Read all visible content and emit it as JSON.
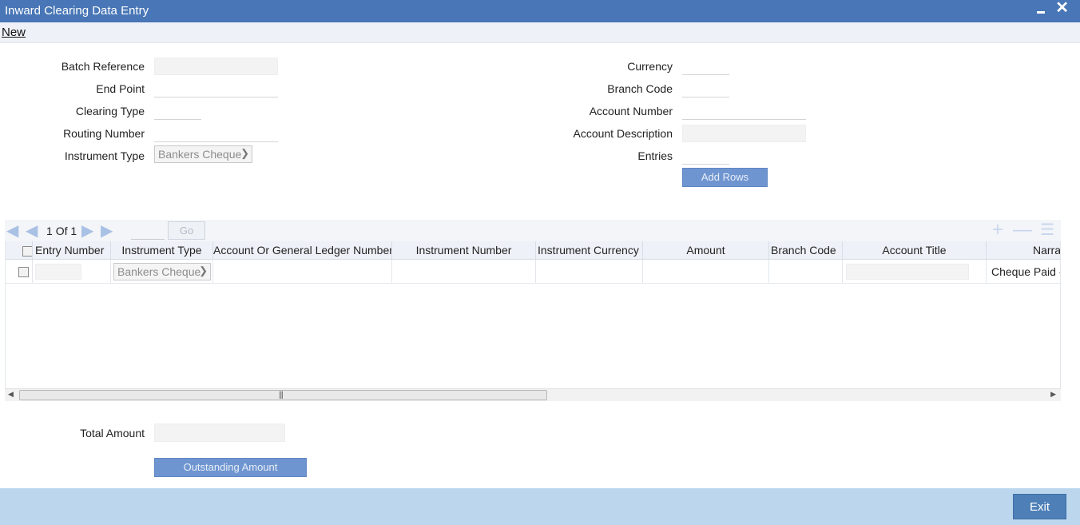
{
  "window": {
    "title": "Inward Clearing Data Entry",
    "minimize_glyph": "▬",
    "close_glyph": "✕"
  },
  "menu": {
    "new_label": "New"
  },
  "form": {
    "batch_reference_label": "Batch Reference",
    "end_point_label": "End Point",
    "clearing_type_label": "Clearing Type",
    "routing_number_label": "Routing Number",
    "instrument_type_label": "Instrument Type",
    "instrument_type_value": "Bankers Cheque",
    "currency_label": "Currency",
    "branch_code_label": "Branch Code",
    "account_number_label": "Account Number",
    "account_description_label": "Account Description",
    "entries_label": "Entries",
    "add_rows_label": "Add Rows"
  },
  "pagination": {
    "current": "1",
    "of_label": "Of",
    "total": "1",
    "go_label": "Go"
  },
  "grid": {
    "columns": [
      "Entry Number",
      "Instrument Type",
      "Account Or General Ledger Number",
      "Instrument Number",
      "Instrument Currency",
      "Amount",
      "Branch Code",
      "Account Title",
      "Narrative"
    ],
    "rows": [
      {
        "instrument_type": "Bankers Cheque",
        "narrative": "Cheque Paid - Cheque"
      }
    ]
  },
  "totals": {
    "total_amount_label": "Total Amount",
    "outstanding_amount_label": "Outstanding Amount"
  },
  "footer": {
    "exit_label": "Exit"
  },
  "colors": {
    "titlebar": "#4876b6",
    "accent_button": "#6f95d0",
    "footer": "#bcd6ee",
    "exit_button": "#4e7fb7"
  },
  "icons": [
    "minimize-icon",
    "close-icon",
    "first-page-icon",
    "prev-page-icon",
    "next-page-icon",
    "last-page-icon",
    "add-row-icon",
    "delete-row-icon",
    "single-view-icon",
    "dropdown-arrow-icon"
  ]
}
